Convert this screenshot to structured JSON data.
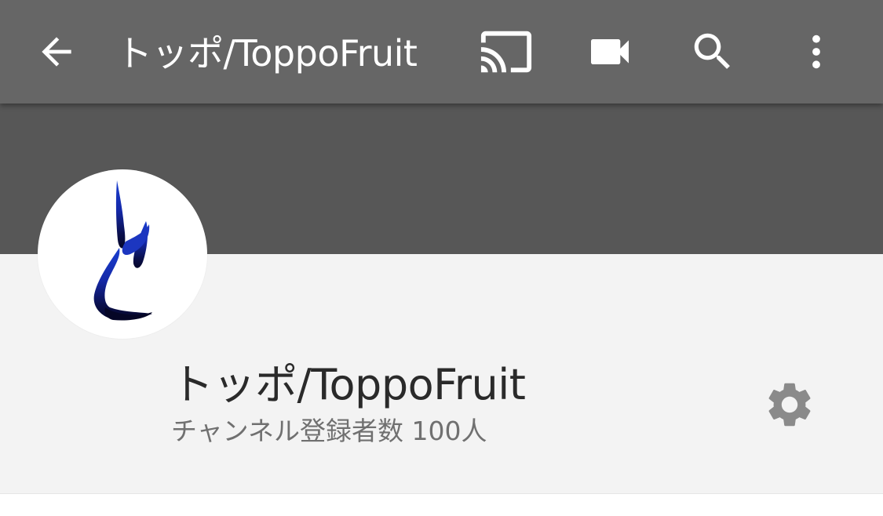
{
  "app_bar": {
    "title": "トッポ/ToppoFruit",
    "icons": [
      "back-arrow-icon",
      "cast-icon",
      "video-camera-icon",
      "search-icon",
      "more-vert-icon"
    ],
    "background": "#666666"
  },
  "banner": {
    "background": "#575757"
  },
  "channel": {
    "name": "トッポ/ToppoFruit",
    "subscribers": "チャンネル登録者数 100人",
    "avatar_icon": "brush-stroke-logo",
    "settings_icon": "gear-icon",
    "logo_color": "#1a2fb5"
  }
}
